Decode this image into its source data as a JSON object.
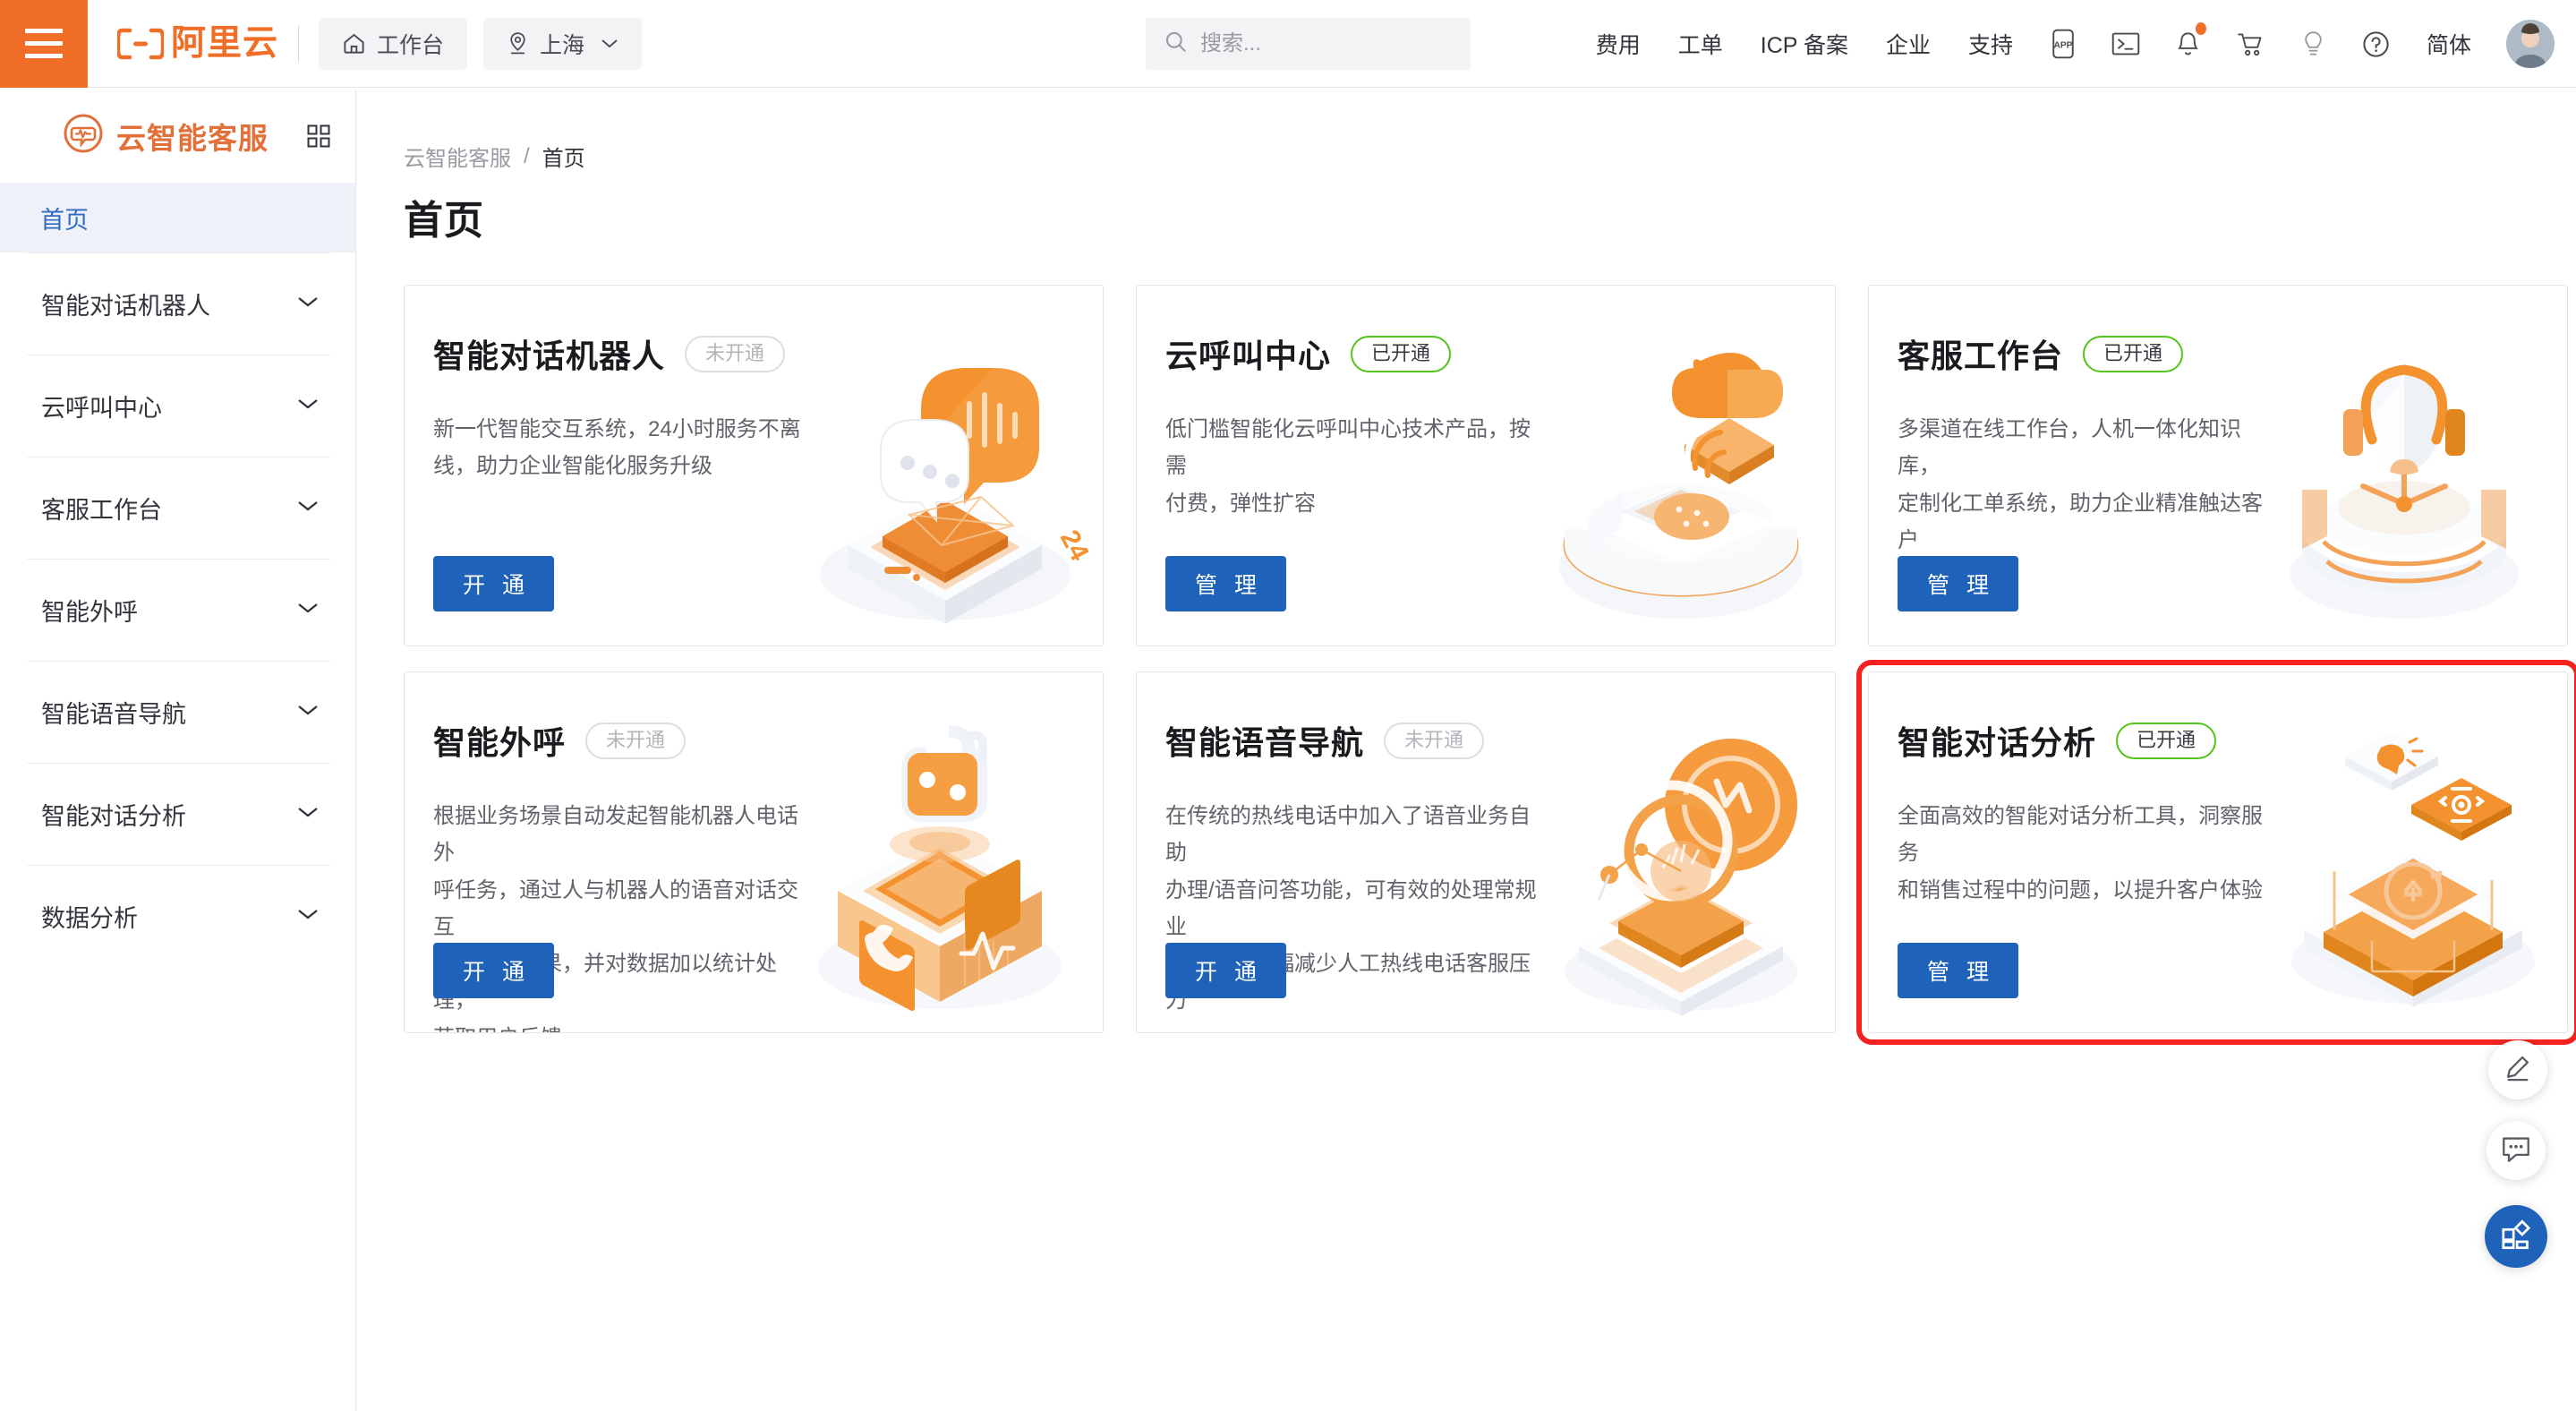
{
  "header": {
    "menu_icon": "hamburger-icon",
    "brand": "阿里云",
    "workbench": {
      "label": "工作台",
      "icon": "home-icon"
    },
    "region": {
      "label": "上海",
      "icon": "location-pin-icon",
      "chevron": "chevron-down-icon"
    },
    "search": {
      "placeholder": "搜索...",
      "value": "",
      "icon": "search-icon"
    },
    "links": [
      "费用",
      "工单",
      "ICP 备案",
      "企业",
      "支持"
    ],
    "icons": [
      "app-icon",
      "terminal-icon",
      "bell-icon",
      "cart-icon",
      "lightbulb-icon",
      "help-circle-icon"
    ],
    "language": "简体",
    "avatar": "user-avatar"
  },
  "sidebar": {
    "product_name": "云智能客服",
    "product_logo": "cloud-service-logo-icon",
    "grid_toggle_icon": "grid-icon",
    "active_item": {
      "label": "首页"
    },
    "groups": [
      {
        "label": "智能对话机器人",
        "chevron": "chevron-down-icon"
      },
      {
        "label": "云呼叫中心",
        "chevron": "chevron-down-icon"
      },
      {
        "label": "客服工作台",
        "chevron": "chevron-down-icon"
      },
      {
        "label": "智能外呼",
        "chevron": "chevron-down-icon"
      },
      {
        "label": "智能语音导航",
        "chevron": "chevron-down-icon"
      },
      {
        "label": "智能对话分析",
        "chevron": "chevron-down-icon"
      },
      {
        "label": "数据分析",
        "chevron": "chevron-down-icon"
      }
    ]
  },
  "main": {
    "breadcrumb": {
      "root": "云智能客服",
      "separator": "/",
      "current": "首页"
    },
    "page_title": "首页",
    "cards": [
      {
        "title": "智能对话机器人",
        "status": "未开通",
        "status_type": "off",
        "description": "新一代智能交互系统，24小时服务不离\n线，助力企业智能化服务升级",
        "action": "开 通",
        "illustration": "chat-bot-illustration",
        "highlighted": false
      },
      {
        "title": "云呼叫中心",
        "status": "已开通",
        "status_type": "on",
        "description": "低门槛智能化云呼叫中心技术产品，按需\n付费，弹性扩容",
        "action": "管 理",
        "illustration": "cloud-call-center-illustration",
        "highlighted": false
      },
      {
        "title": "客服工作台",
        "status": "已开通",
        "status_type": "on",
        "description": "多渠道在线工作台，人机一体化知识库，\n定制化工单系统，助力企业精准触达客户",
        "action": "管 理",
        "illustration": "headset-workbench-illustration",
        "highlighted": false
      },
      {
        "title": "智能外呼",
        "status": "未开通",
        "status_type": "off",
        "description": "根据业务场景自动发起智能机器人电话外\n呼任务，通过人与机器人的语音对话交互\n收集业务结果，并对数据加以统计处理，\n获取用户反馈",
        "action": "开 通",
        "illustration": "robot-outbound-illustration",
        "highlighted": false
      },
      {
        "title": "智能语音导航",
        "status": "未开通",
        "status_type": "off",
        "description": "在传统的热线电话中加入了语音业务自助\n办理/语音问答功能，可有效的处理常规业\n务场景，大幅减少人工热线电话客服压力",
        "action": "开 通",
        "illustration": "voice-navigation-illustration",
        "highlighted": false
      },
      {
        "title": "智能对话分析",
        "status": "已开通",
        "status_type": "on",
        "description": "全面高效的智能对话分析工具，洞察服务\n和销售过程中的问题，以提升客户体验",
        "action": "管 理",
        "illustration": "dialog-analysis-illustration",
        "highlighted": true
      }
    ]
  },
  "floating_actions": [
    {
      "icon": "pencil-edit-icon",
      "style": "white"
    },
    {
      "icon": "feedback-chat-icon",
      "style": "white"
    },
    {
      "icon": "apps-grid-icon",
      "style": "blue"
    }
  ],
  "colors": {
    "brand_orange": "#f06e28",
    "primary_blue": "#1f62b9",
    "active_nav_blue": "#2f6bc4",
    "status_on_green": "#52c41a",
    "status_off_gray": "#b4b4bb",
    "highlight_red": "#f5231f",
    "sidebar_active_bg": "#eef2f8"
  }
}
